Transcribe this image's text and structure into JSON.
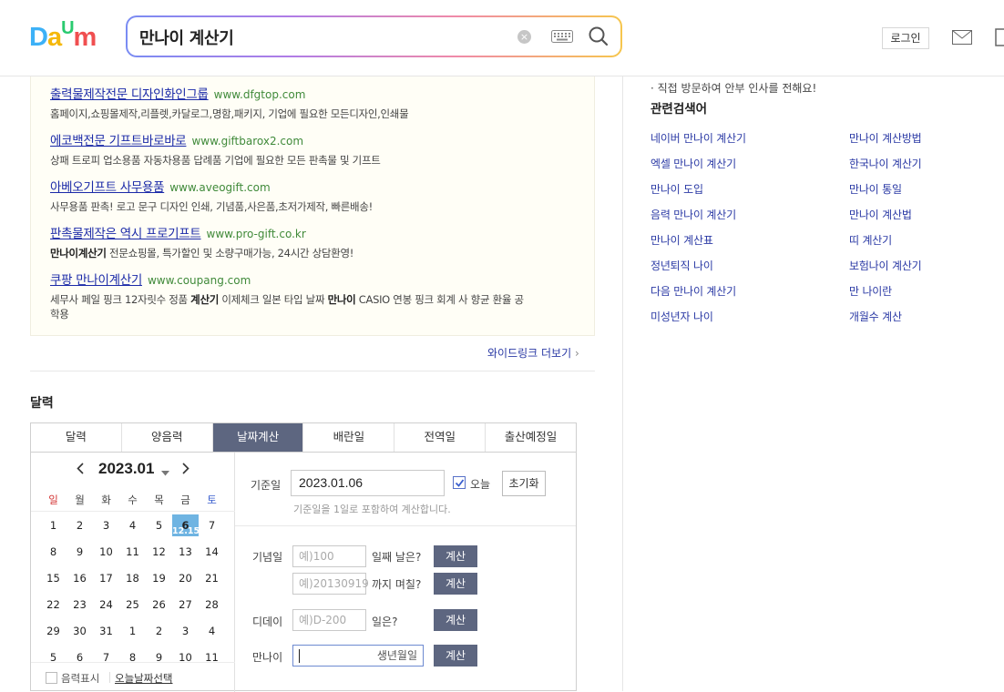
{
  "header": {
    "logo_letters": [
      {
        "ch": "D",
        "color": "#3cb1f7"
      },
      {
        "ch": "a",
        "color": "#f5b80b"
      },
      {
        "ch": "U",
        "color": "#2aca6f"
      },
      {
        "ch": "m",
        "color": "#f04f50"
      }
    ],
    "search_query": "만나이 계산기",
    "login_label": "로그인"
  },
  "ads": [
    {
      "title": "출력물제작전문 디자인화인그룹",
      "url": "www.dfgtop.com",
      "desc": "홈페이지,쇼핑몰제작,리플렛,카달로그,명함,패키지, 기업에 필요한 모든디자인,인쇄물"
    },
    {
      "title": "에코백전문 기프트바로바로",
      "url": "www.giftbarox2.com",
      "desc": "상패 트로피 업소용품 자동차용품 답례품 기업에 필요한 모든 판촉물 및 기프트"
    },
    {
      "title": "아베오기프트 사무용품",
      "url": "www.aveogift.com",
      "desc": "사무용품 판촉! 로고 문구 디자인 인쇄, 기념품,사은품,초저가제작, 빠른배송!"
    },
    {
      "title": "판촉물제작은 역시 프로기프트",
      "url": "www.pro-gift.co.kr",
      "desc_bold": "만나이계산기",
      "desc": " 전문쇼핑몰, 특가할인 및 소량구매가능, 24시간 상담환영!"
    },
    {
      "title": "쿠팡 만나이계산기",
      "url": "www.coupang.com",
      "desc_parts": [
        "세무사 페일 핑크 12자릿수 정품 ",
        "계산기",
        " 이제체크 일본 타입 날짜 ",
        "만나이",
        " CASIO 연봉 핑크 회계 사 향균 환율 공학용"
      ]
    }
  ],
  "wide_more": "와이드링크 더보기",
  "calendar_section": {
    "title": "달력",
    "tabs": [
      "달력",
      "양음력",
      "날짜계산",
      "배란일",
      "전역일",
      "출산예정일"
    ],
    "active_tab": 2,
    "month_label": "2023.01",
    "dow": [
      "일",
      "월",
      "화",
      "수",
      "목",
      "금",
      "토"
    ],
    "weeks": [
      [
        "1",
        "2",
        "3",
        "4",
        "5",
        "6",
        "7"
      ],
      [
        "8",
        "9",
        "10",
        "11",
        "12",
        "13",
        "14"
      ],
      [
        "15",
        "16",
        "17",
        "18",
        "19",
        "20",
        "21"
      ],
      [
        "22",
        "23",
        "24",
        "25",
        "26",
        "27",
        "28"
      ],
      [
        "29",
        "30",
        "31",
        "1",
        "2",
        "3",
        "4"
      ],
      [
        "5",
        "6",
        "7",
        "8",
        "9",
        "10",
        "11"
      ]
    ],
    "today_lunar": "12.15",
    "lunar_label": "음력표시",
    "today_select_label": "오늘날짜선택"
  },
  "date_calc": {
    "base_label": "기준일",
    "base_value": "2023.01.06",
    "today_check_label": "오늘",
    "reset_label": "초기화",
    "hint": "기준일을 1일로 포함하여 계산합니다.",
    "anniv_label": "기념일",
    "anniv_placeholder1": "예)100",
    "anniv_q1": "일째 날은?",
    "anniv_placeholder2": "예)20130919",
    "anniv_q2": "까지 며칠?",
    "dday_label": "디데이",
    "dday_placeholder": "예)D-200",
    "dday_q": "일은?",
    "age_label": "만나이",
    "age_placeholder": "생년월일",
    "calc_label": "계산"
  },
  "sidebar": {
    "notice": "· 직접 방문하여 안부 인사를 전해요!",
    "related_title": "관련검색어",
    "related_left": [
      "네이버 만나이 계산기",
      "엑셀 만나이 계산기",
      "만나이 도입",
      "음력 만나이 계산기",
      "만나이 계산표",
      "정년퇴직 나이",
      "다음 만나이 계산기",
      "미성년자 나이"
    ],
    "related_right": [
      "만나이 계산방법",
      "한국나이 계산기",
      "만나이 통일",
      "만나이 계산법",
      "띠 계산기",
      "보험나이 계산기",
      "만 나이란",
      "개월수 계산"
    ]
  }
}
